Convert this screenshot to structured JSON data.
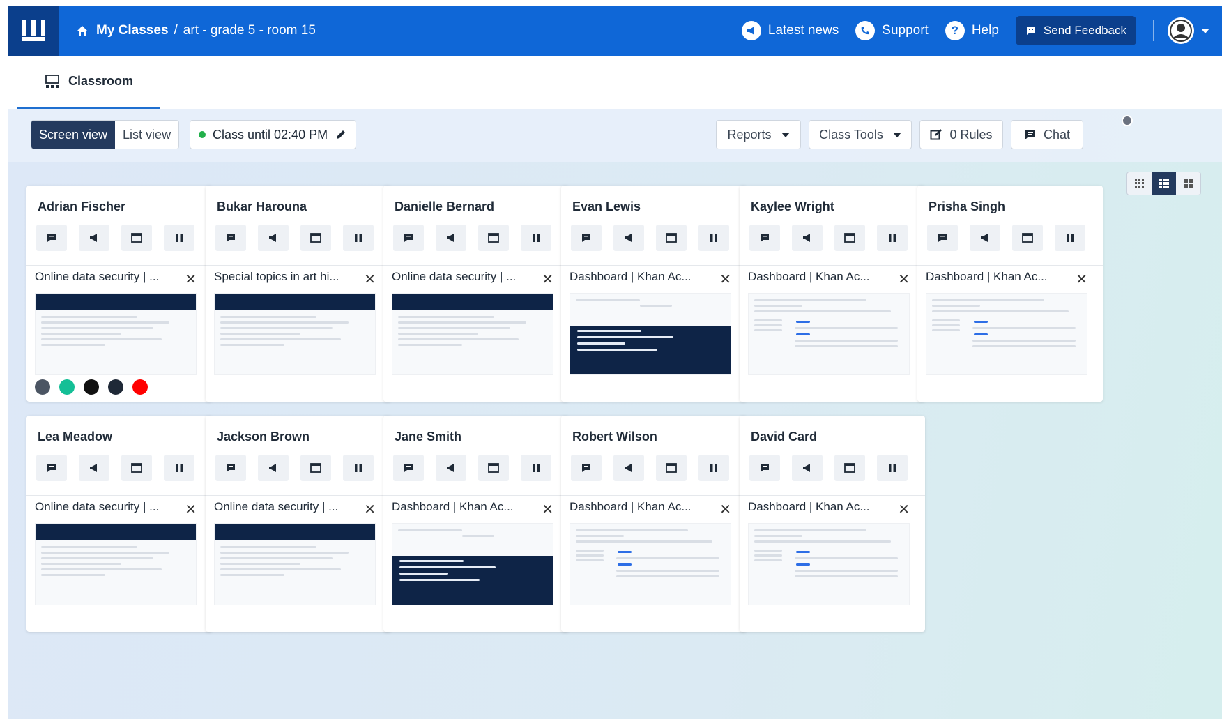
{
  "header": {
    "breadcrumb": {
      "root": "My Classes",
      "separator": "/",
      "current": "art - grade 5 - room 15"
    },
    "links": [
      {
        "label": "Latest news",
        "icon": "megaphone-icon"
      },
      {
        "label": "Support",
        "icon": "phone-icon"
      },
      {
        "label": "Help",
        "icon": "help-icon"
      }
    ],
    "feedback_label": "Send Feedback"
  },
  "tab": {
    "label": "Classroom"
  },
  "toolbar": {
    "view_screen": "Screen view",
    "view_list": "List view",
    "class_until": "Class until 02:40 PM",
    "reports": "Reports",
    "class_tools": "Class Tools",
    "rules": "0 Rules",
    "chat": "Chat"
  },
  "colors": {
    "primary": "#0f67d7",
    "dark_navy": "#0b3f8c",
    "active_segment": "#243a5e",
    "status_green": "#22b04b"
  },
  "students": [
    {
      "name": "Adrian Fischer",
      "tab_title": "Online data security | ...",
      "preview": "security",
      "favicons": [
        "chrome-icon",
        "khan-icon",
        "notion-icon",
        "readwise-icon",
        "youtube-icon"
      ]
    },
    {
      "name": "Bukar Harouna",
      "tab_title": "Special topics in art hi...",
      "preview": "art",
      "favicons": []
    },
    {
      "name": "Danielle Bernard",
      "tab_title": "Online data security | ...",
      "preview": "security",
      "favicons": []
    },
    {
      "name": "Evan Lewis",
      "tab_title": "Dashboard | Khan Ac...",
      "preview": "khan-dark",
      "favicons": []
    },
    {
      "name": "Kaylee Wright",
      "tab_title": "Dashboard | Khan Ac...",
      "preview": "dashboard",
      "favicons": []
    },
    {
      "name": "Prisha Singh",
      "tab_title": "Dashboard | Khan Ac...",
      "preview": "dashboard",
      "favicons": []
    },
    {
      "name": "Lea Meadow",
      "tab_title": "Online data security | ...",
      "preview": "security",
      "favicons": []
    },
    {
      "name": "Jackson Brown",
      "tab_title": "Online data security | ...",
      "preview": "security",
      "favicons": []
    },
    {
      "name": "Jane Smith",
      "tab_title": "Dashboard | Khan Ac...",
      "preview": "khan-dark",
      "favicons": []
    },
    {
      "name": "Robert Wilson",
      "tab_title": "Dashboard | Khan Ac...",
      "preview": "dashboard",
      "favicons": []
    },
    {
      "name": "David Card",
      "tab_title": "Dashboard | Khan Ac...",
      "preview": "dashboard",
      "favicons": []
    }
  ]
}
